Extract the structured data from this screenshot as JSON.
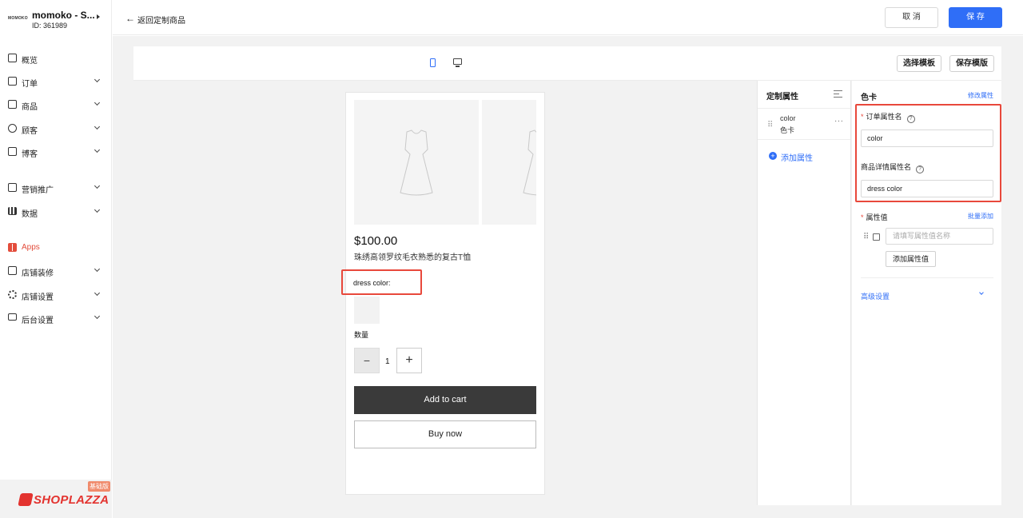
{
  "store": {
    "logo_text": "MOMOKO",
    "name": "momoko - S...",
    "id": "ID: 361989"
  },
  "sidebar": {
    "items": [
      {
        "label": "概览",
        "icon": "overview-icon"
      },
      {
        "label": "订单",
        "icon": "order-icon"
      },
      {
        "label": "商品",
        "icon": "product-bag-icon"
      },
      {
        "label": "顾客",
        "icon": "customer-icon"
      },
      {
        "label": "博客",
        "icon": "blog-icon"
      },
      {
        "label": "营销推广",
        "icon": "marketing-icon"
      },
      {
        "label": "数据",
        "icon": "analytics-icon"
      },
      {
        "label": "Apps",
        "icon": "apps-icon"
      },
      {
        "label": "店铺装修",
        "icon": "storefront-icon"
      },
      {
        "label": "店铺设置",
        "icon": "settings-gear-icon"
      },
      {
        "label": "后台设置",
        "icon": "monitor-icon"
      }
    ]
  },
  "brand": {
    "name": "SHOPLAZZA",
    "badge": "基础版",
    "accent": "#e3332f"
  },
  "topbar": {
    "back_arrow": "←",
    "back_label": "返回定制商品",
    "cancel_label": "取 消",
    "save_label": "保 存"
  },
  "editor": {
    "choose_template": "选择模板",
    "save_template": "保存模版"
  },
  "product": {
    "price": "$100.00",
    "title": "珠绣高领罗纹毛衣熟悉的复古T恤",
    "attr_label": "dress color:",
    "qty_label": "数量",
    "qty_minus": "−",
    "qty_value": "1",
    "qty_plus": "+",
    "add_to_cart": "Add to cart",
    "buy_now": "Buy now"
  },
  "attributes": {
    "title": "定制属性",
    "items": [
      {
        "name": "color",
        "sub": "色卡"
      }
    ],
    "drag_handle": "⠿",
    "more": "···",
    "add_plus": "+",
    "add_label": "添加属性"
  },
  "settings": {
    "title": "色卡",
    "edit_link": "修改属性",
    "required_mark": "*",
    "help_mark": "?",
    "order_attr_label": "订单属性名",
    "order_attr_value": "color",
    "detail_attr_label": "商品详情属性名",
    "detail_attr_value": "dress color",
    "values_label": "属性值",
    "batch_add": "批量添加",
    "value_placeholder": "请填写属性值名称",
    "add_value_button": "添加属性值",
    "advanced": "高级设置"
  },
  "colors": {
    "primary": "#2f6ef7",
    "highlight": "#e8483b",
    "dark_button": "#3a3a3a"
  }
}
